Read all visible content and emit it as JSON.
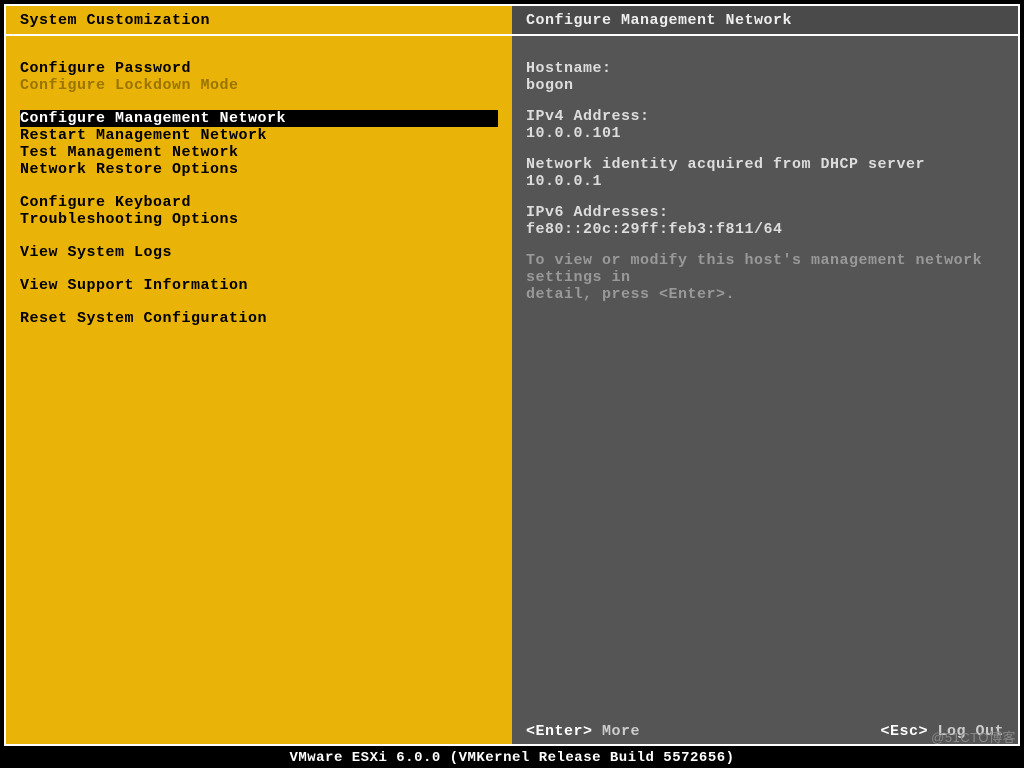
{
  "left_header": "System Customization",
  "right_header": "Configure Management Network",
  "menu": {
    "g1": {
      "i1": "Configure Password",
      "i2": "Configure Lockdown Mode"
    },
    "g2": {
      "i1": "Configure Management Network",
      "i2": "Restart Management Network",
      "i3": "Test Management Network",
      "i4": "Network Restore Options"
    },
    "g3": {
      "i1": "Configure Keyboard",
      "i2": "Troubleshooting Options"
    },
    "g4": {
      "i1": "View System Logs"
    },
    "g5": {
      "i1": "View Support Information"
    },
    "g6": {
      "i1": "Reset System Configuration"
    }
  },
  "details": {
    "hostname_label": "Hostname:",
    "hostname_value": "bogon",
    "ipv4_label": "IPv4 Address:",
    "ipv4_value": "10.0.0.101",
    "dhcp_msg": "Network identity acquired from DHCP server 10.0.0.1",
    "ipv6_label": "IPv6 Addresses:",
    "ipv6_value": "fe80::20c:29ff:feb3:f811/64",
    "hint1": "To view or modify this host's management network settings in",
    "hint2": "detail, press <Enter>."
  },
  "footer": {
    "enter_key": "<Enter>",
    "enter_action": " More",
    "esc_key": "<Esc>",
    "esc_action": " Log Out"
  },
  "status_bar": "VMware ESXi 6.0.0 (VMKernel Release Build 5572656)",
  "watermark": "@51CTO博客"
}
